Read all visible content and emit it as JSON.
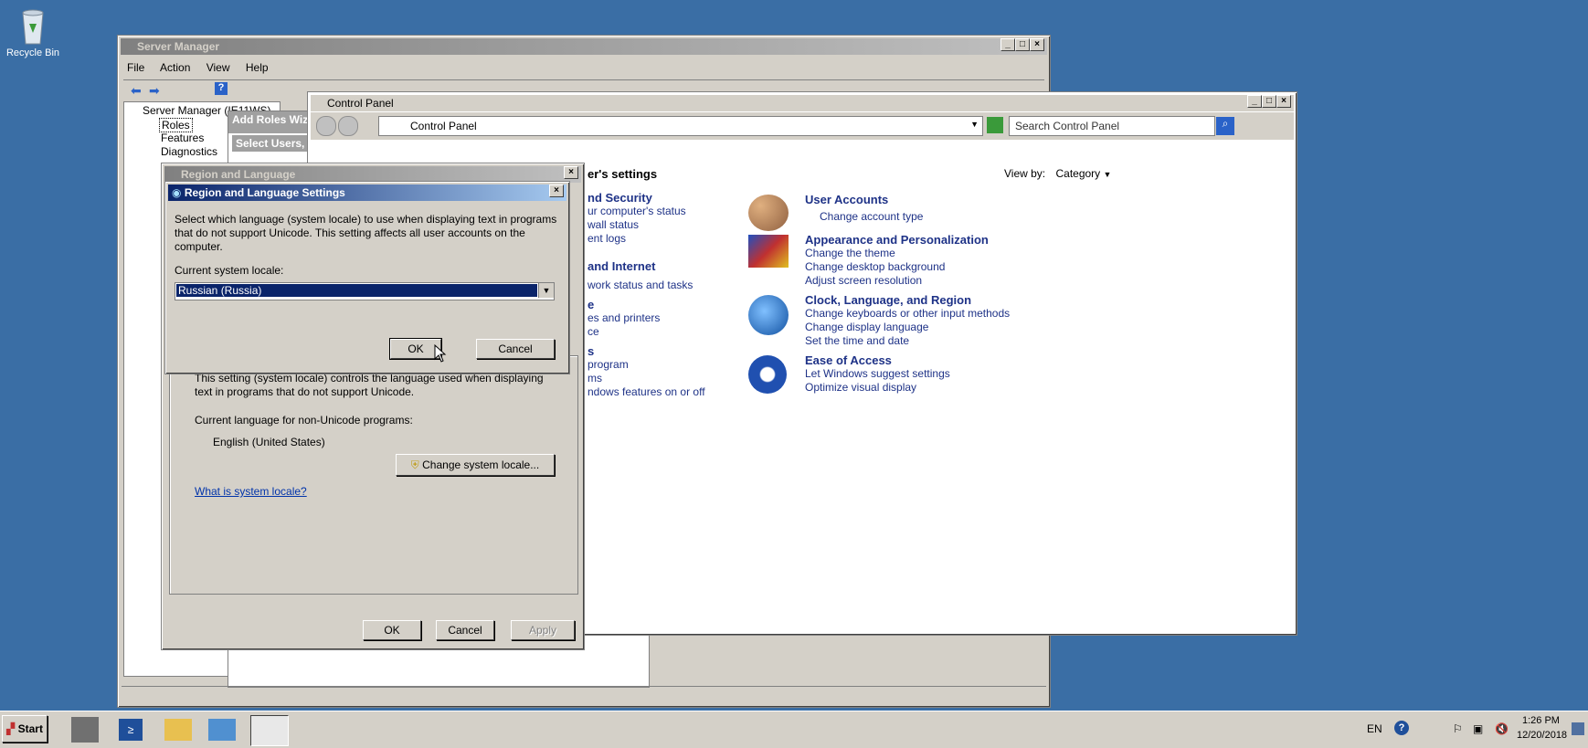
{
  "desktop": {
    "recycle_bin": "Recycle Bin"
  },
  "server_manager": {
    "title": "Server Manager",
    "menu": [
      "File",
      "Action",
      "View",
      "Help"
    ],
    "tree": {
      "root": "Server Manager (IE11WS)",
      "roles": "Roles",
      "features": "Features",
      "diagnostics": "Diagnostics"
    },
    "wizard_title": "Add Roles Wiz",
    "wizard_step": "Select Users,"
  },
  "control_panel": {
    "title": "Control Panel",
    "breadcrumb": "Control Panel",
    "search_placeholder": "Search Control Panel",
    "heading_partial": "er's settings",
    "view_by_label": "View by:",
    "view_by_value": "Category",
    "left_items": [
      "nd Security",
      "ur computer's status",
      "wall status",
      "ent logs",
      "and Internet",
      "work status and tasks",
      "e",
      "es and printers",
      "ce",
      "s",
      "program",
      "ms",
      "ndows features on or off"
    ],
    "categories": [
      {
        "title": "User Accounts",
        "links": [
          "Change account type"
        ]
      },
      {
        "title": "Appearance and Personalization",
        "links": [
          "Change the theme",
          "Change desktop background",
          "Adjust screen resolution"
        ]
      },
      {
        "title": "Clock, Language, and Region",
        "links": [
          "Change keyboards or other input methods",
          "Change display language",
          "Set the time and date"
        ]
      },
      {
        "title": "Ease of Access",
        "links": [
          "Let Windows suggest settings",
          "Optimize visual display"
        ]
      }
    ]
  },
  "region_dialog": {
    "title": "Region and Language",
    "body_text_line1": "This setting (system locale) controls the language used when displaying",
    "body_text_line2": "text in programs that do not support Unicode.",
    "current_label": "Current language for non-Unicode programs:",
    "current_value": "English (United States)",
    "change_button": "Change system locale...",
    "link": "What is system locale?",
    "ok": "OK",
    "cancel": "Cancel",
    "apply": "Apply"
  },
  "settings_dialog": {
    "title": "Region and Language Settings",
    "description_line1": "Select which language (system locale) to use when displaying text in programs",
    "description_line2": "that do not support Unicode. This setting affects all user accounts on the",
    "description_line3": "computer.",
    "locale_label": "Current system locale:",
    "locale_value": "Russian (Russia)",
    "ok": "OK",
    "cancel": "Cancel"
  },
  "taskbar": {
    "start": "Start",
    "lang": "EN",
    "time": "1:26 PM",
    "date": "12/20/2018"
  },
  "colors": {
    "desktop": "#3a6ea5",
    "link": "#1e3287",
    "active_title": "#0a246a"
  }
}
